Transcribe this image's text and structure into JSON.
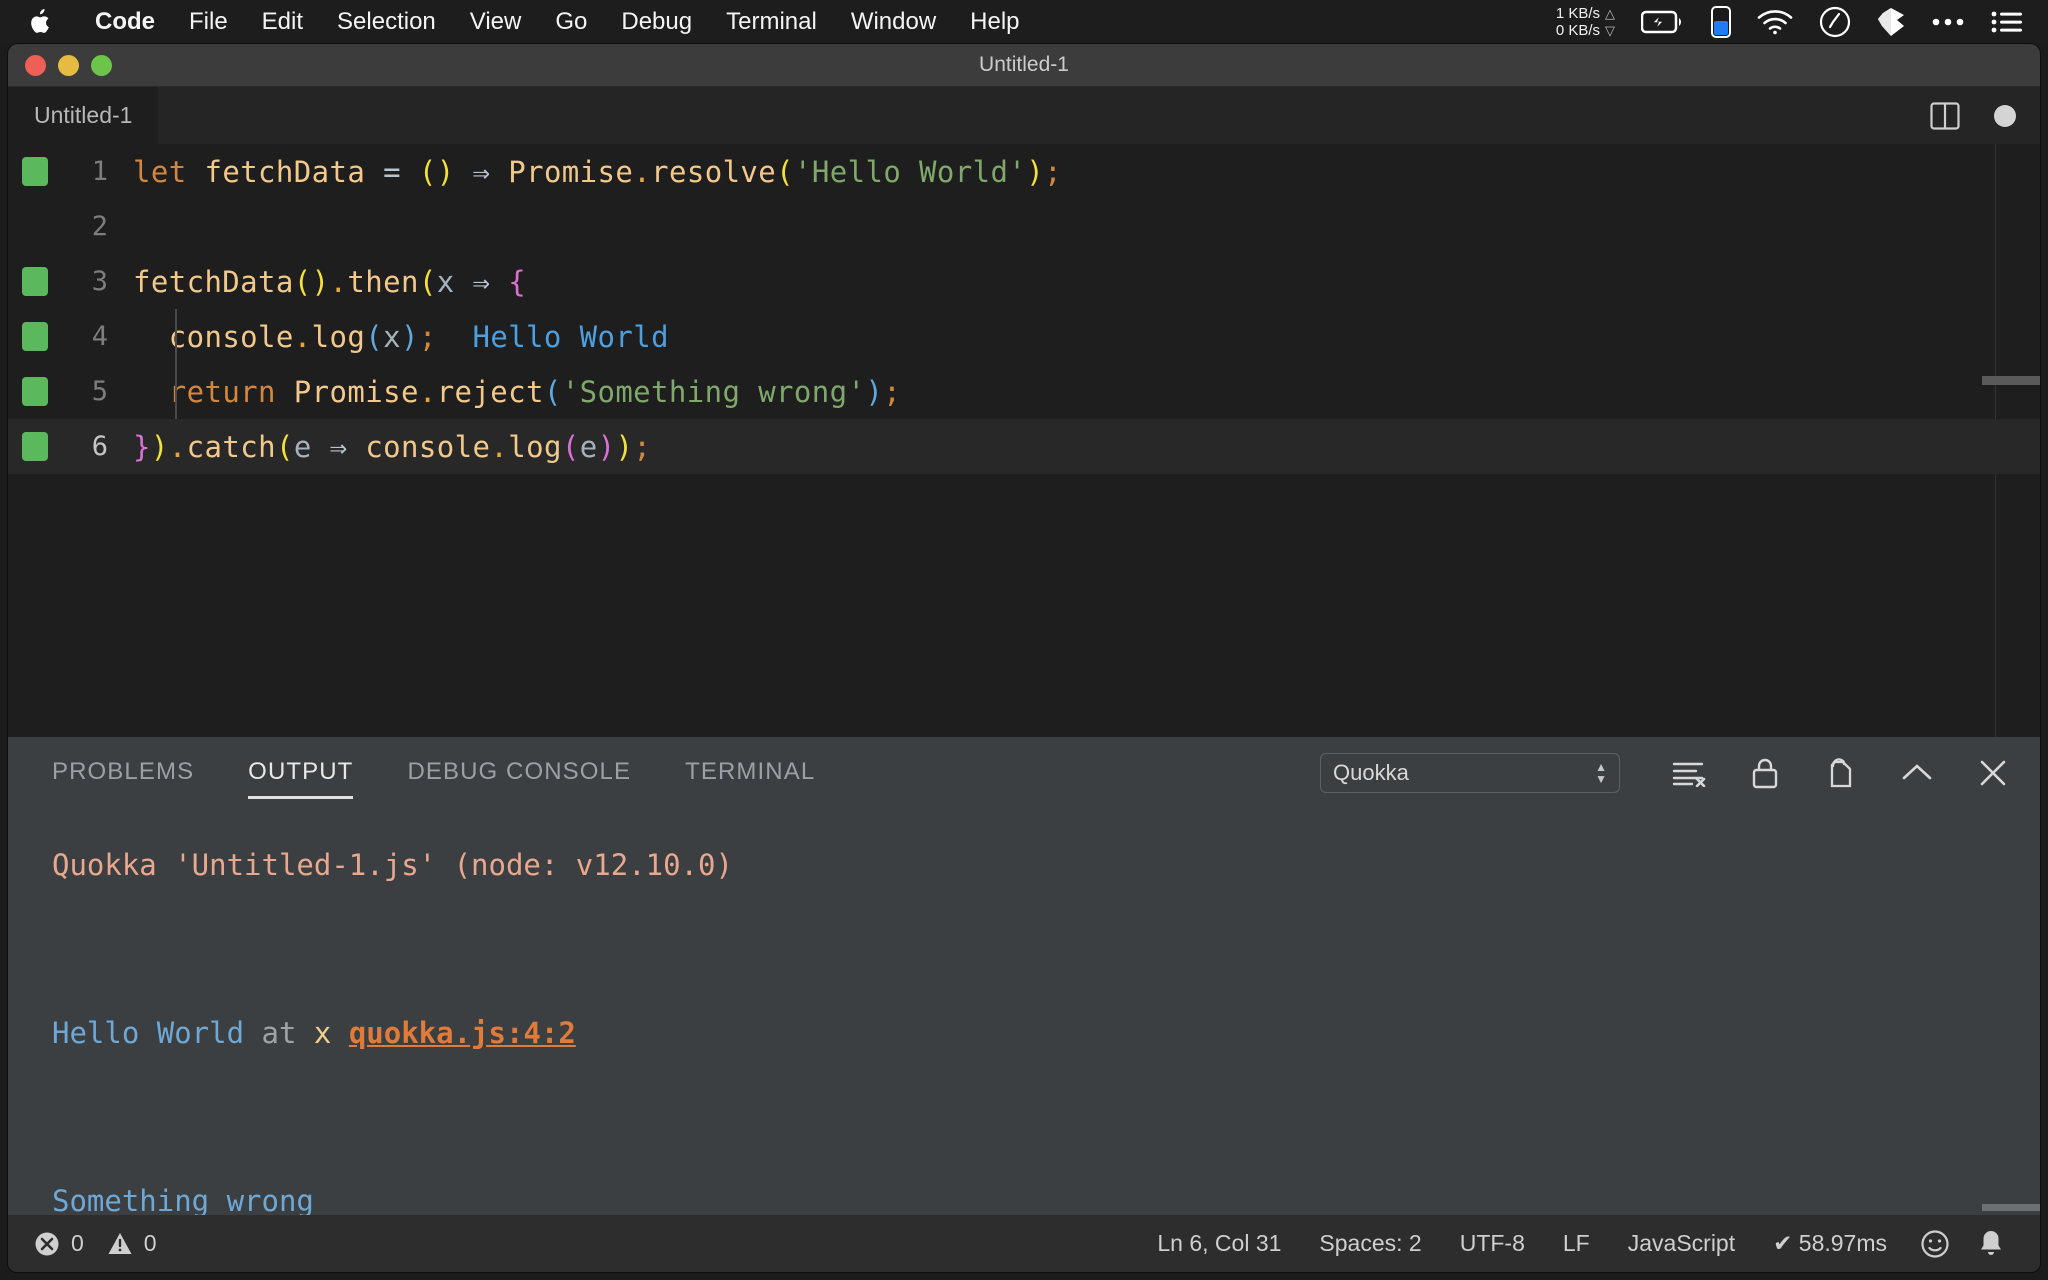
{
  "macmenu": {
    "apple_icon": "apple-logo-icon",
    "items": [
      {
        "label": "Code",
        "bold": true
      },
      {
        "label": "File",
        "bold": false
      },
      {
        "label": "Edit",
        "bold": false
      },
      {
        "label": "Selection",
        "bold": false
      },
      {
        "label": "View",
        "bold": false
      },
      {
        "label": "Go",
        "bold": false
      },
      {
        "label": "Debug",
        "bold": false
      },
      {
        "label": "Terminal",
        "bold": false
      },
      {
        "label": "Window",
        "bold": false
      },
      {
        "label": "Help",
        "bold": false
      }
    ],
    "tray": {
      "upload_speed": "1 KB/s",
      "download_speed": "0 KB/s",
      "up_arrow": "△",
      "down_arrow": "▽",
      "icons": [
        "battery-charging-icon",
        "phone-battery-icon",
        "wifi-icon",
        "clock-icon",
        "dropbox-icon",
        "ellipsis-icon",
        "control-center-icon"
      ]
    }
  },
  "window": {
    "title": "Untitled-1",
    "traffic_lights": [
      "close-button",
      "minimize-button",
      "zoom-button"
    ]
  },
  "tabbar": {
    "tabs": [
      {
        "label": "Untitled-1",
        "active": true,
        "dirty": true
      }
    ],
    "actions": [
      "split-editor-icon",
      "dirty-indicator-dot"
    ]
  },
  "editor": {
    "lines": [
      {
        "number": "1",
        "marker": true,
        "indent_guide": false,
        "tokens": [
          {
            "text": "let",
            "cls": "t-kw"
          },
          {
            "text": " ",
            "cls": "t-plain"
          },
          {
            "text": "fetchData",
            "cls": "t-var"
          },
          {
            "text": " ",
            "cls": "t-plain"
          },
          {
            "text": "=",
            "cls": "t-op"
          },
          {
            "text": " ",
            "cls": "t-plain"
          },
          {
            "text": "(",
            "cls": "t-par1"
          },
          {
            "text": ")",
            "cls": "t-par1"
          },
          {
            "text": " ",
            "cls": "t-plain"
          },
          {
            "text": "⇒",
            "cls": "t-op"
          },
          {
            "text": " ",
            "cls": "t-plain"
          },
          {
            "text": "Promise",
            "cls": "t-fn"
          },
          {
            "text": ".",
            "cls": "t-dot"
          },
          {
            "text": "resolve",
            "cls": "t-fn"
          },
          {
            "text": "(",
            "cls": "t-par1"
          },
          {
            "text": "'Hello World'",
            "cls": "t-str"
          },
          {
            "text": ")",
            "cls": "t-par1"
          },
          {
            "text": ";",
            "cls": "t-semi"
          }
        ]
      },
      {
        "number": "2",
        "marker": false,
        "indent_guide": false,
        "tokens": []
      },
      {
        "number": "3",
        "marker": true,
        "indent_guide": false,
        "tokens": [
          {
            "text": "fetchData",
            "cls": "t-fn"
          },
          {
            "text": "(",
            "cls": "t-par1"
          },
          {
            "text": ")",
            "cls": "t-par1"
          },
          {
            "text": ".",
            "cls": "t-dot"
          },
          {
            "text": "then",
            "cls": "t-fn"
          },
          {
            "text": "(",
            "cls": "t-par1"
          },
          {
            "text": "x",
            "cls": "t-ident"
          },
          {
            "text": " ",
            "cls": "t-plain"
          },
          {
            "text": "⇒",
            "cls": "t-op"
          },
          {
            "text": " ",
            "cls": "t-plain"
          },
          {
            "text": "{",
            "cls": "t-par2"
          }
        ]
      },
      {
        "number": "4",
        "marker": true,
        "indent_guide": true,
        "tokens": [
          {
            "text": "  ",
            "cls": "t-plain"
          },
          {
            "text": "console",
            "cls": "t-fn"
          },
          {
            "text": ".",
            "cls": "t-dot"
          },
          {
            "text": "log",
            "cls": "t-fn"
          },
          {
            "text": "(",
            "cls": "t-par3"
          },
          {
            "text": "x",
            "cls": "t-ident"
          },
          {
            "text": ")",
            "cls": "t-par3"
          },
          {
            "text": ";",
            "cls": "t-semi"
          },
          {
            "text": "  ",
            "cls": "t-plain"
          },
          {
            "text": "Hello World",
            "cls": "t-quokka"
          }
        ]
      },
      {
        "number": "5",
        "marker": true,
        "indent_guide": true,
        "tokens": [
          {
            "text": "  ",
            "cls": "t-plain"
          },
          {
            "text": "return",
            "cls": "t-kw"
          },
          {
            "text": " ",
            "cls": "t-plain"
          },
          {
            "text": "Promise",
            "cls": "t-fn"
          },
          {
            "text": ".",
            "cls": "t-dot"
          },
          {
            "text": "reject",
            "cls": "t-fn"
          },
          {
            "text": "(",
            "cls": "t-par3"
          },
          {
            "text": "'Something wrong'",
            "cls": "t-str"
          },
          {
            "text": ")",
            "cls": "t-par3"
          },
          {
            "text": ";",
            "cls": "t-semi"
          }
        ]
      },
      {
        "number": "6",
        "marker": true,
        "active": true,
        "indent_guide": false,
        "tokens": [
          {
            "text": "}",
            "cls": "t-par2"
          },
          {
            "text": ")",
            "cls": "t-par1"
          },
          {
            "text": ".",
            "cls": "t-dot"
          },
          {
            "text": "catch",
            "cls": "t-fn"
          },
          {
            "text": "(",
            "cls": "t-par1"
          },
          {
            "text": "e",
            "cls": "t-ident"
          },
          {
            "text": " ",
            "cls": "t-plain"
          },
          {
            "text": "⇒",
            "cls": "t-op"
          },
          {
            "text": " ",
            "cls": "t-plain"
          },
          {
            "text": "console",
            "cls": "t-fn"
          },
          {
            "text": ".",
            "cls": "t-dot"
          },
          {
            "text": "log",
            "cls": "t-fn"
          },
          {
            "text": "(",
            "cls": "t-par2"
          },
          {
            "text": "e",
            "cls": "t-ident"
          },
          {
            "text": ")",
            "cls": "t-par2"
          },
          {
            "text": ")",
            "cls": "t-par1"
          },
          {
            "text": ";",
            "cls": "t-semi"
          }
        ]
      }
    ]
  },
  "panel": {
    "tabs": [
      {
        "label": "PROBLEMS",
        "active": false
      },
      {
        "label": "OUTPUT",
        "active": true
      },
      {
        "label": "DEBUG CONSOLE",
        "active": false
      },
      {
        "label": "TERMINAL",
        "active": false
      }
    ],
    "channel_select": {
      "value": "Quokka"
    },
    "actions": [
      "clear-output-icon",
      "lock-scroll-icon",
      "open-in-editor-icon",
      "maximize-panel-icon",
      "close-panel-icon"
    ],
    "output": [
      {
        "id": "line-header",
        "segments": [
          {
            "text": "Quokka 'Untitled-1.js' (node: v12.10.0)",
            "cls": "o-head"
          }
        ]
      },
      {
        "id": "line-blank",
        "segments": [
          {
            "text": "",
            "cls": "o-gray"
          }
        ]
      },
      {
        "id": "line-hello",
        "segments": [
          {
            "text": "Hello World",
            "cls": "o-blue"
          },
          {
            "text": " at ",
            "cls": "o-gray"
          },
          {
            "text": "x",
            "cls": "o-yellow"
          },
          {
            "text": " ",
            "cls": "o-gray"
          },
          {
            "text": "quokka.js:4:2",
            "cls": "o-link"
          }
        ]
      },
      {
        "id": "line-blank2",
        "segments": [
          {
            "text": "",
            "cls": "o-gray"
          }
        ]
      },
      {
        "id": "line-error",
        "segments": [
          {
            "text": "Something wrong",
            "cls": "o-blue"
          }
        ]
      }
    ]
  },
  "statusbar": {
    "errors": "0",
    "warnings": "0",
    "position": "Ln 6, Col 31",
    "indentation": "Spaces: 2",
    "encoding": "UTF-8",
    "eol": "LF",
    "language": "JavaScript",
    "quokka_time": "✔ 58.97ms",
    "icons": [
      "error-icon",
      "warning-icon",
      "feedback-smiley-icon",
      "notifications-bell-icon"
    ]
  },
  "colors": {
    "accent_green": "#5cb85c",
    "link_orange": "#e07b39",
    "quokka_blue": "#4c9fe0",
    "panel_bg": "#3c3f41",
    "editor_bg": "#1e1e1e"
  }
}
